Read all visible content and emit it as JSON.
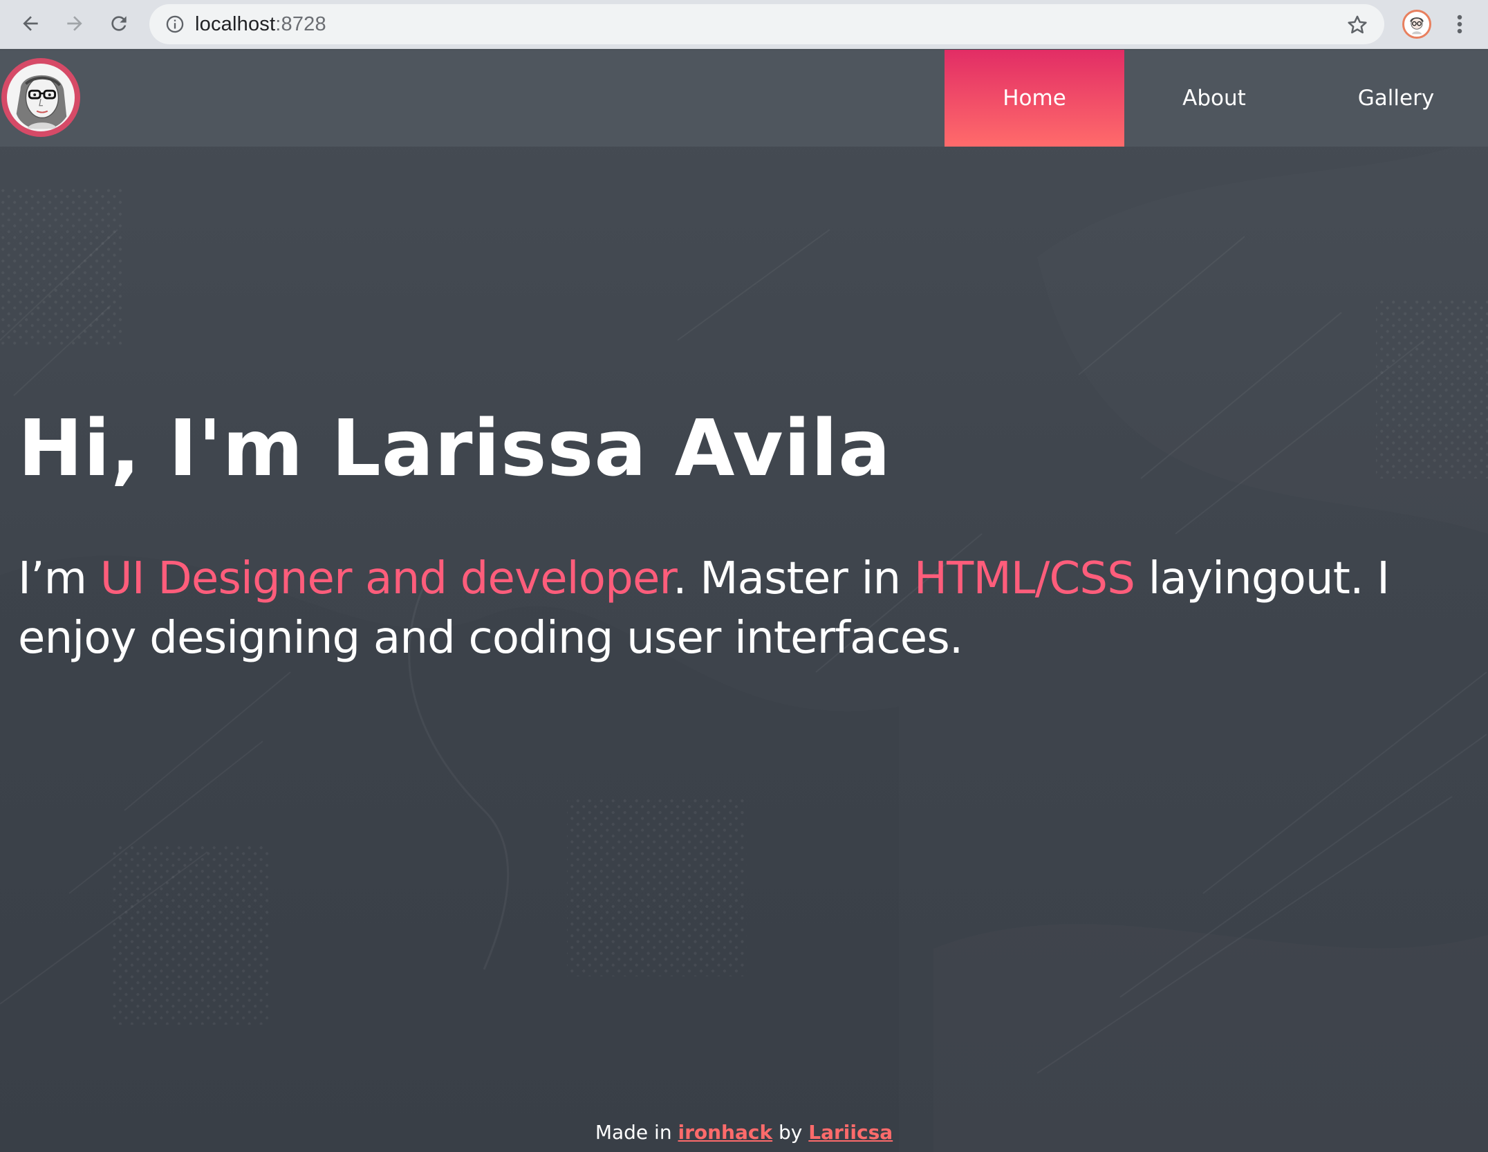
{
  "browser": {
    "url_host": "localhost",
    "url_port": ":8728",
    "back_icon": "arrow-left-icon",
    "forward_icon": "arrow-right-icon",
    "reload_icon": "reload-icon",
    "info_icon": "info-icon",
    "bookmark_icon": "star-icon",
    "menu_icon": "kebab-menu-icon"
  },
  "navbar": {
    "items": [
      {
        "label": "Home",
        "active": true
      },
      {
        "label": "About",
        "active": false
      },
      {
        "label": "Gallery",
        "active": false
      }
    ]
  },
  "hero": {
    "title": "Hi, I'm Larissa Avila",
    "line_prefix": "I’m ",
    "line_accent_1": "UI Designer and developer",
    "line_middle": ". Master in ",
    "line_accent_2": "HTML/CSS",
    "line_suffix": " layingout. I enjoy designing and coding user interfaces."
  },
  "footer": {
    "made_in": "Made in ",
    "link_1": "ironhack",
    "by": " by ",
    "link_2": "Lariicsa"
  },
  "colors": {
    "accent": "#ff5d7b",
    "nav_active_top": "#e22d65",
    "nav_active_bottom": "#ff6b6b",
    "background": "#3f454d",
    "navbar": "#4f565e"
  }
}
